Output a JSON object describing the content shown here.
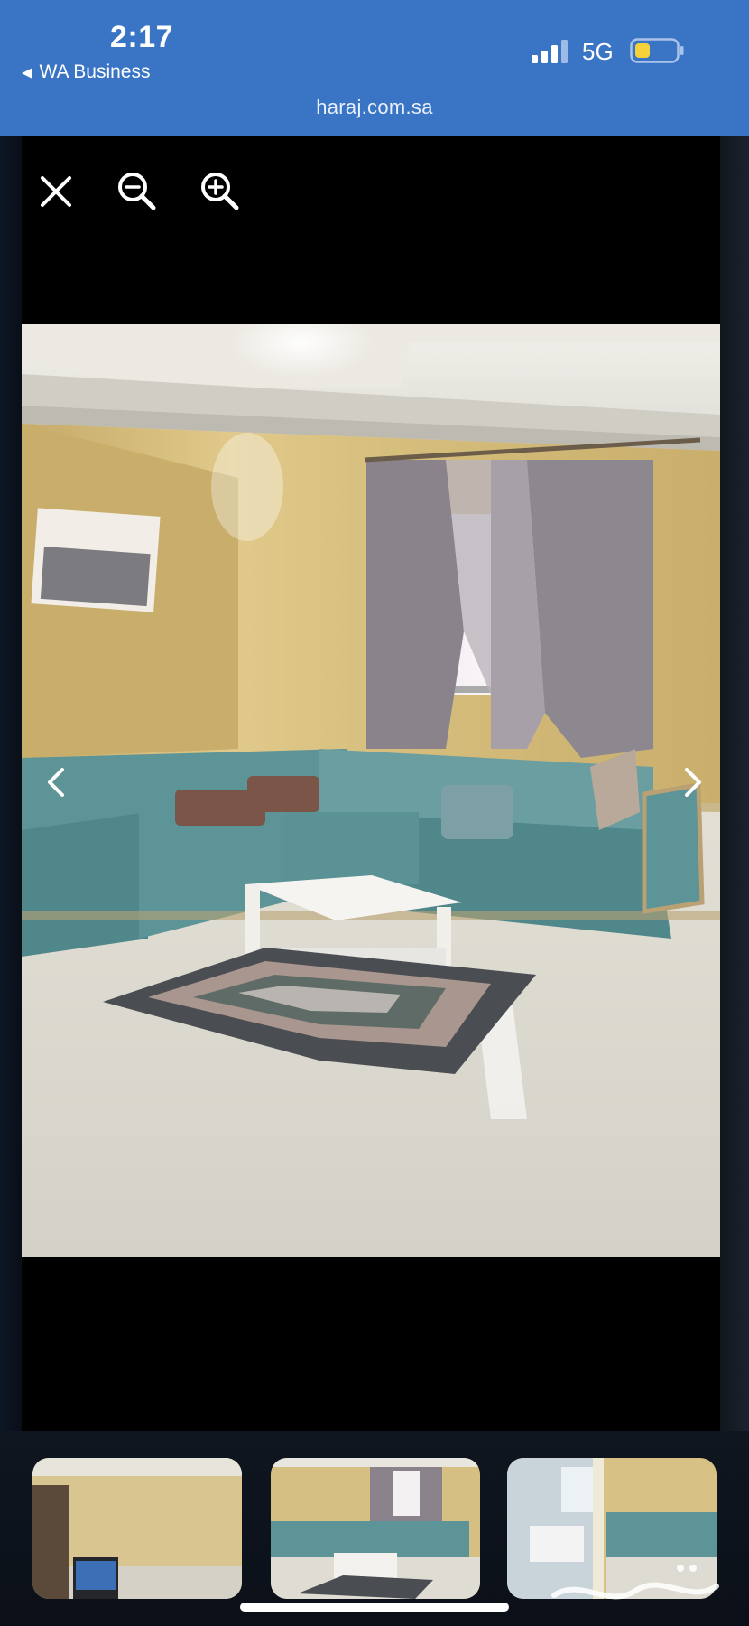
{
  "status_bar": {
    "time": "2:17",
    "back_label": "WA Business",
    "back_icon": "back-triangle-icon",
    "network": "5G",
    "signal_icon": "cellular-signal-icon",
    "battery_icon": "battery-low-icon",
    "battery_color": "#f5d23a"
  },
  "browser": {
    "url": "haraj.com.sa",
    "accent_color": "#3a74c4"
  },
  "viewer": {
    "toolbar": {
      "close_icon": "close-icon",
      "zoom_out_icon": "zoom-out-icon",
      "zoom_in_icon": "zoom-in-icon"
    },
    "prev_icon": "chevron-left-icon",
    "next_icon": "chevron-right-icon",
    "thumbnails_count": 3,
    "watermark": "حراج"
  }
}
